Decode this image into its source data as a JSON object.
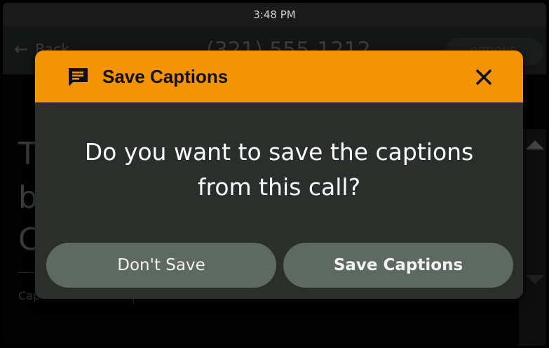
{
  "status_bar": {
    "time": "3:48 PM"
  },
  "header": {
    "back_label": "Back",
    "phone_number": "(321) 555-1212",
    "options_label": "OPTIONS"
  },
  "captions": {
    "visible_fragments": [
      "T",
      "b",
      "C"
    ],
    "footer_fragment": "Cap"
  },
  "dialog": {
    "title": "Save Captions",
    "icon": "message-icon",
    "message": "Do you want to save the captions from this call?",
    "buttons": {
      "dont_save": "Don't Save",
      "save": "Save Captions"
    }
  },
  "colors": {
    "dialog_header": "#f49304",
    "dialog_body": "#2b2f2c",
    "button_bg": "#5e6962"
  }
}
